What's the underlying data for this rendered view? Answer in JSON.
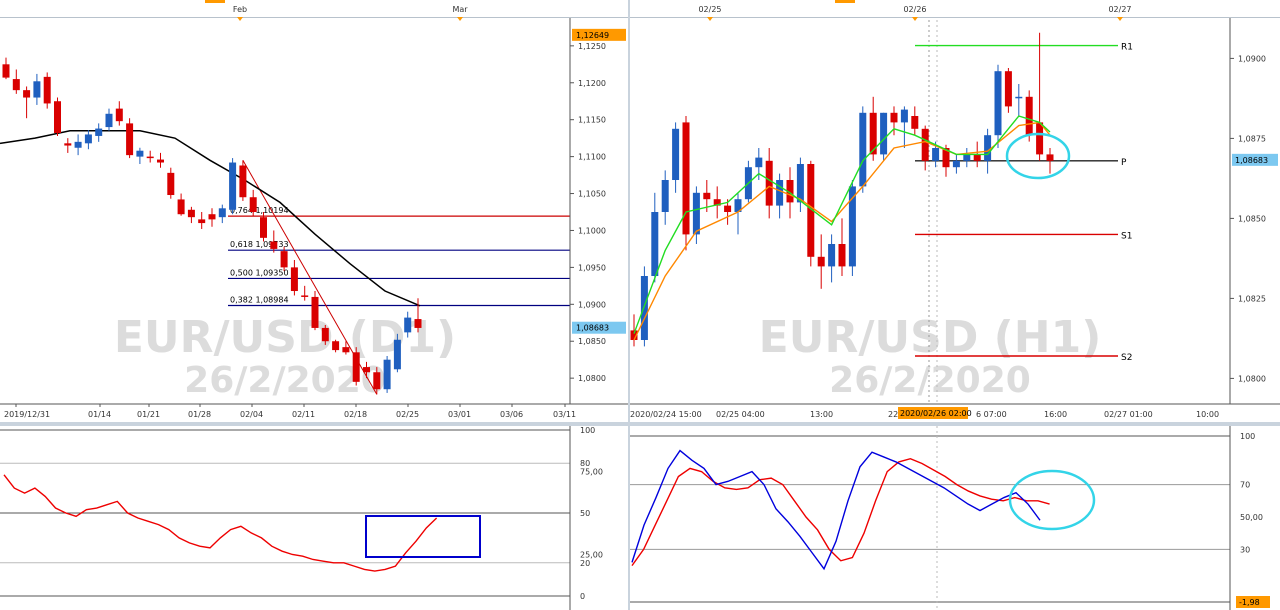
{
  "left_chart": {
    "top_labels": [
      "Feb",
      "Mar"
    ],
    "watermark": [
      "EUR/USD (D1)",
      "26/2/2020"
    ],
    "y_ticks": [
      "1,1250",
      "1,1200",
      "1,1150",
      "1,1100",
      "1,1050",
      "1,1000",
      "1,0950",
      "1,0900",
      "1,0850",
      "1,0800"
    ],
    "top_price": "1,12649",
    "current_price": "1,08683",
    "x_ticks": [
      "2019/12/31",
      "01/14",
      "01/21",
      "01/28",
      "02/04",
      "02/11",
      "02/18",
      "02/25",
      "03/01",
      "03/06",
      "03/11"
    ],
    "fib_labels": [
      "0,764 1,10194",
      "0,618 1,09733",
      "0,500 1,09350",
      "0,382 1,08984"
    ],
    "osc_ticks": [
      "100",
      "80",
      "75,00",
      "50",
      "25,00",
      "20",
      "0"
    ]
  },
  "right_chart": {
    "top_labels": [
      "02/25",
      "02/26",
      "02/27"
    ],
    "watermark": [
      "EUR/USD (H1)",
      "26/2/2020"
    ],
    "y_ticks": [
      "1,0900",
      "1,0875",
      "1,0850",
      "1,0825",
      "1,0800"
    ],
    "current_price": "1,08683",
    "x_ticks": [
      "2020/02/24 15:00",
      "02/25 04:00",
      "13:00",
      "22",
      "6 07:00",
      "16:00",
      "02/27 01:00",
      "10:00"
    ],
    "highlight_time": "2020/02/26 02:00",
    "pivot_labels": [
      "R1",
      "P",
      "S1",
      "S2"
    ],
    "osc_ticks": [
      "100",
      "70",
      "50,00",
      "30",
      "-1,98"
    ]
  },
  "colors": {
    "bull": "#1f5fbf",
    "bear": "#d90000",
    "ma": "#000000",
    "fast_ma": "#22dd22",
    "slow_ma": "#ff8800",
    "fib": "#000080",
    "fib_red": "#cc0000",
    "osc_main": "#ee0000",
    "osc_signal": "#0000dd",
    "highlight": "#33d4e8",
    "box": "#0000cc",
    "price_tag": "#ff9900"
  },
  "chart_data": [
    {
      "type": "candlestick",
      "title": "EUR/USD (D1)",
      "ylim": [
        1.0765,
        1.1285
      ],
      "x": [
        "2019/12/31",
        "01/14",
        "01/21",
        "01/28",
        "02/04",
        "02/11",
        "02/18",
        "02/25",
        "03/01",
        "03/06",
        "03/11"
      ],
      "candles": [
        [
          1.1225,
          1.1234,
          1.1205,
          1.1207
        ],
        [
          1.1205,
          1.1218,
          1.1185,
          1.119
        ],
        [
          1.119,
          1.1195,
          1.1152,
          1.118
        ],
        [
          1.118,
          1.1212,
          1.117,
          1.1202
        ],
        [
          1.1208,
          1.1214,
          1.1165,
          1.1172
        ],
        [
          1.1175,
          1.118,
          1.1128,
          1.1132
        ],
        [
          1.1118,
          1.1125,
          1.1105,
          1.1115
        ],
        [
          1.1112,
          1.113,
          1.1102,
          1.112
        ],
        [
          1.1118,
          1.1136,
          1.111,
          1.113
        ],
        [
          1.1128,
          1.1145,
          1.112,
          1.1138
        ],
        [
          1.114,
          1.1165,
          1.1135,
          1.1158
        ],
        [
          1.1165,
          1.1175,
          1.1142,
          1.1148
        ],
        [
          1.1145,
          1.1152,
          1.1098,
          1.1102
        ],
        [
          1.11,
          1.1112,
          1.109,
          1.1108
        ],
        [
          1.11,
          1.1108,
          1.1092,
          1.1098
        ],
        [
          1.1096,
          1.1105,
          1.1085,
          1.1092
        ],
        [
          1.1078,
          1.1085,
          1.1043,
          1.1048
        ],
        [
          1.1042,
          1.105,
          1.102,
          1.1022
        ],
        [
          1.1028,
          1.1032,
          1.101,
          1.1018
        ],
        [
          1.1015,
          1.1025,
          1.1002,
          1.101
        ],
        [
          1.1022,
          1.103,
          1.1005,
          1.1015
        ],
        [
          1.1018,
          1.1035,
          1.101,
          1.103
        ],
        [
          1.1028,
          1.1098,
          1.1022,
          1.1092
        ],
        [
          1.1088,
          1.1095,
          1.104,
          1.1045
        ],
        [
          1.1045,
          1.1055,
          1.102,
          1.1025
        ],
        [
          1.1018,
          1.1025,
          1.0985,
          1.099
        ],
        [
          1.0985,
          1.1,
          1.097,
          1.0975
        ],
        [
          1.0972,
          1.0978,
          1.0945,
          1.095
        ],
        [
          1.095,
          1.096,
          1.0912,
          1.0918
        ],
        [
          1.0912,
          1.0925,
          1.0905,
          1.091
        ],
        [
          1.091,
          1.0918,
          1.0865,
          1.0868
        ],
        [
          1.0868,
          1.0872,
          1.0845,
          1.085
        ],
        [
          1.085,
          1.0852,
          1.0835,
          1.0838
        ],
        [
          1.0842,
          1.085,
          1.0832,
          1.0835
        ],
        [
          1.0835,
          1.0842,
          1.079,
          1.0795
        ],
        [
          1.0815,
          1.0822,
          1.08,
          1.0808
        ],
        [
          1.0808,
          1.0815,
          1.0778,
          1.0785
        ],
        [
          1.0785,
          1.083,
          1.078,
          1.0825
        ],
        [
          1.0812,
          1.086,
          1.0808,
          1.0852
        ],
        [
          1.0862,
          1.089,
          1.0855,
          1.0882
        ],
        [
          1.088,
          1.0908,
          1.0862,
          1.0868
        ]
      ],
      "ma": [
        [
          0,
          1.1118
        ],
        [
          4,
          1.1125
        ],
        [
          8,
          1.1135
        ],
        [
          12,
          1.1135
        ],
        [
          16,
          1.1135
        ],
        [
          20,
          1.1125
        ],
        [
          24,
          1.1095
        ],
        [
          28,
          1.1068
        ],
        [
          32,
          1.1038
        ],
        [
          36,
          1.0995
        ],
        [
          40,
          1.0955
        ],
        [
          44,
          1.0918
        ],
        [
          48,
          1.0898
        ]
      ],
      "fib_levels": [
        1.10194,
        1.09733,
        1.0935,
        1.08984
      ],
      "osc": [
        73,
        65,
        62,
        65,
        60,
        53,
        50,
        48,
        52,
        53,
        55,
        57,
        50,
        47,
        45,
        43,
        40,
        35,
        32,
        30,
        29,
        35,
        40,
        42,
        38,
        35,
        30,
        27,
        25,
        24,
        22,
        21,
        20,
        20,
        18,
        16,
        15,
        16,
        18,
        26,
        33,
        41,
        47
      ]
    },
    {
      "type": "candlestick",
      "title": "EUR/USD (H1)",
      "ylim": [
        1.0792,
        1.0912
      ],
      "x": [
        "2020/02/24 15:00",
        "02/25 04:00",
        "13:00",
        "22",
        "6 07:00",
        "16:00",
        "02/27 01:00",
        "10:00"
      ],
      "candles": [
        [
          1.0815,
          1.082,
          1.081,
          1.0812
        ],
        [
          1.0812,
          1.0835,
          1.081,
          1.0832
        ],
        [
          1.0832,
          1.0858,
          1.083,
          1.0852
        ],
        [
          1.0852,
          1.0865,
          1.0848,
          1.0862
        ],
        [
          1.0862,
          1.088,
          1.0858,
          1.0878
        ],
        [
          1.088,
          1.0882,
          1.084,
          1.0845
        ],
        [
          1.0845,
          1.086,
          1.0842,
          1.0858
        ],
        [
          1.0858,
          1.0862,
          1.0852,
          1.0856
        ],
        [
          1.0856,
          1.086,
          1.085,
          1.0854
        ],
        [
          1.0854,
          1.0856,
          1.0848,
          1.0852
        ],
        [
          1.0852,
          1.0858,
          1.0845,
          1.0856
        ],
        [
          1.0856,
          1.0868,
          1.0855,
          1.0866
        ],
        [
          1.0866,
          1.0872,
          1.0862,
          1.0869
        ],
        [
          1.0868,
          1.0872,
          1.085,
          1.0854
        ],
        [
          1.0854,
          1.0864,
          1.085,
          1.0862
        ],
        [
          1.0862,
          1.0866,
          1.085,
          1.0855
        ],
        [
          1.0855,
          1.0869,
          1.0852,
          1.0867
        ],
        [
          1.0867,
          1.0868,
          1.0835,
          1.0838
        ],
        [
          1.0838,
          1.0845,
          1.0828,
          1.0835
        ],
        [
          1.0835,
          1.0845,
          1.083,
          1.0842
        ],
        [
          1.0842,
          1.085,
          1.0832,
          1.0835
        ],
        [
          1.0835,
          1.0862,
          1.0832,
          1.086
        ],
        [
          1.086,
          1.0885,
          1.0858,
          1.0883
        ],
        [
          1.0883,
          1.0888,
          1.0868,
          1.087
        ],
        [
          1.087,
          1.0883,
          1.0868,
          1.0883
        ],
        [
          1.0883,
          1.0885,
          1.0876,
          1.088
        ],
        [
          1.088,
          1.0885,
          1.0872,
          1.0884
        ],
        [
          1.0882,
          1.0885,
          1.0876,
          1.0878
        ],
        [
          1.0878,
          1.0879,
          1.0865,
          1.0868
        ],
        [
          1.0868,
          1.0874,
          1.0866,
          1.0872
        ],
        [
          1.0872,
          1.0873,
          1.0863,
          1.0866
        ],
        [
          1.0866,
          1.087,
          1.0864,
          1.0868
        ],
        [
          1.0868,
          1.0872,
          1.0866,
          1.087
        ],
        [
          1.087,
          1.0874,
          1.0866,
          1.0868
        ],
        [
          1.0868,
          1.0878,
          1.0864,
          1.0876
        ],
        [
          1.0876,
          1.0898,
          1.0872,
          1.0896
        ],
        [
          1.0896,
          1.0897,
          1.0883,
          1.0885
        ],
        [
          1.0888,
          1.0892,
          1.0882,
          1.0888
        ],
        [
          1.0888,
          1.089,
          1.0874,
          1.0876
        ],
        [
          1.088,
          1.0908,
          1.0868,
          1.087
        ],
        [
          1.087,
          1.0872,
          1.0864,
          1.0868
        ]
      ],
      "fast_ma": [
        [
          0,
          1.0814
        ],
        [
          3,
          1.084
        ],
        [
          5,
          1.0852
        ],
        [
          9,
          1.0855
        ],
        [
          12,
          1.0864
        ],
        [
          15,
          1.0858
        ],
        [
          19,
          1.0848
        ],
        [
          22,
          1.0868
        ],
        [
          25,
          1.0878
        ],
        [
          27,
          1.0876
        ],
        [
          31,
          1.087
        ],
        [
          34,
          1.087
        ],
        [
          37,
          1.0882
        ],
        [
          39,
          1.088
        ],
        [
          40,
          1.0877
        ]
      ],
      "slow_ma": [
        [
          0,
          1.0812
        ],
        [
          3,
          1.0832
        ],
        [
          6,
          1.0846
        ],
        [
          10,
          1.0852
        ],
        [
          13,
          1.086
        ],
        [
          16,
          1.0856
        ],
        [
          19,
          1.0849
        ],
        [
          22,
          1.086
        ],
        [
          25,
          1.0872
        ],
        [
          28,
          1.0874
        ],
        [
          31,
          1.087
        ],
        [
          34,
          1.0871
        ],
        [
          37,
          1.0879
        ],
        [
          39,
          1.088
        ],
        [
          40,
          1.0876
        ]
      ],
      "pivots": [
        1.0904,
        1.0868,
        1.0845,
        1.0807
      ],
      "osc_main": [
        20,
        30,
        45,
        60,
        75,
        80,
        78,
        72,
        68,
        67,
        68,
        73,
        74,
        70,
        60,
        50,
        42,
        30,
        23,
        25,
        40,
        60,
        78,
        84,
        86,
        83,
        79,
        75,
        70,
        66,
        63,
        61,
        60,
        62,
        60,
        60,
        58
      ],
      "osc_signal": [
        22,
        45,
        62,
        80,
        91,
        85,
        80,
        70,
        72,
        75,
        78,
        70,
        55,
        47,
        38,
        28,
        18,
        35,
        60,
        81,
        90,
        87,
        84,
        80,
        76,
        72,
        68,
        63,
        58,
        54,
        58,
        62,
        65,
        58,
        48
      ]
    }
  ]
}
